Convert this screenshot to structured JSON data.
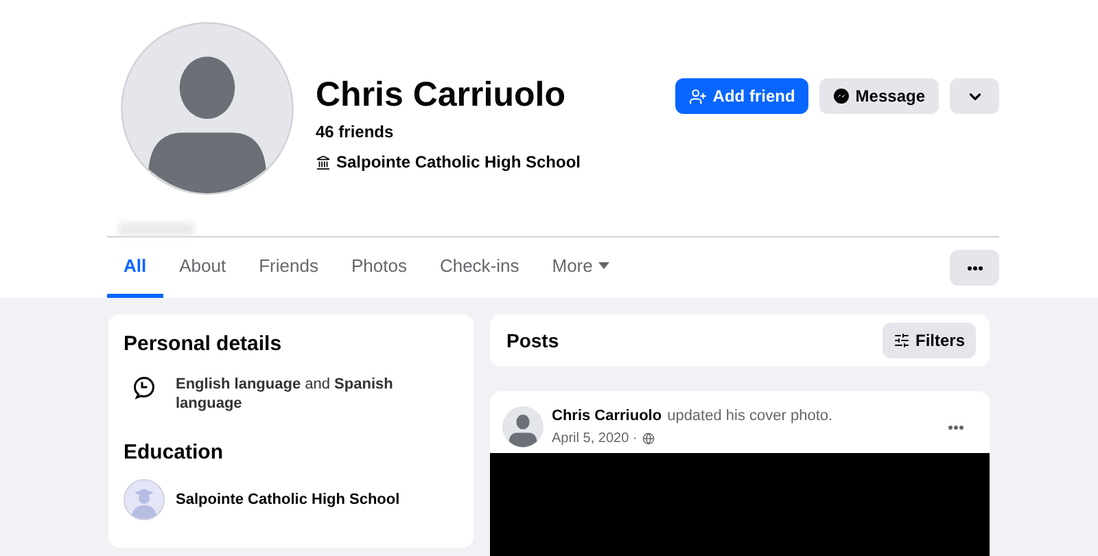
{
  "profile": {
    "name": "Chris Carriuolo",
    "friends": "46 friends",
    "school": "Salpointe Catholic High School"
  },
  "actions": {
    "add_friend": "Add friend",
    "message": "Message"
  },
  "tabs": [
    {
      "label": "All",
      "selected": true
    },
    {
      "label": "About",
      "selected": false
    },
    {
      "label": "Friends",
      "selected": false
    },
    {
      "label": "Photos",
      "selected": false
    },
    {
      "label": "Check-ins",
      "selected": false
    },
    {
      "label": "More",
      "selected": false,
      "kind": "menu"
    }
  ],
  "personal_details": {
    "title": "Personal details",
    "languages": "**English language** and **Spanish language**"
  },
  "education": {
    "title": "Education",
    "school": "Salpointe Catholic High School"
  },
  "posts": {
    "title": "Posts",
    "filters": "Filters",
    "post": {
      "author": "Chris Carriuolo",
      "action": "updated his cover photo.",
      "date": "April 5, 2020 ·"
    }
  }
}
